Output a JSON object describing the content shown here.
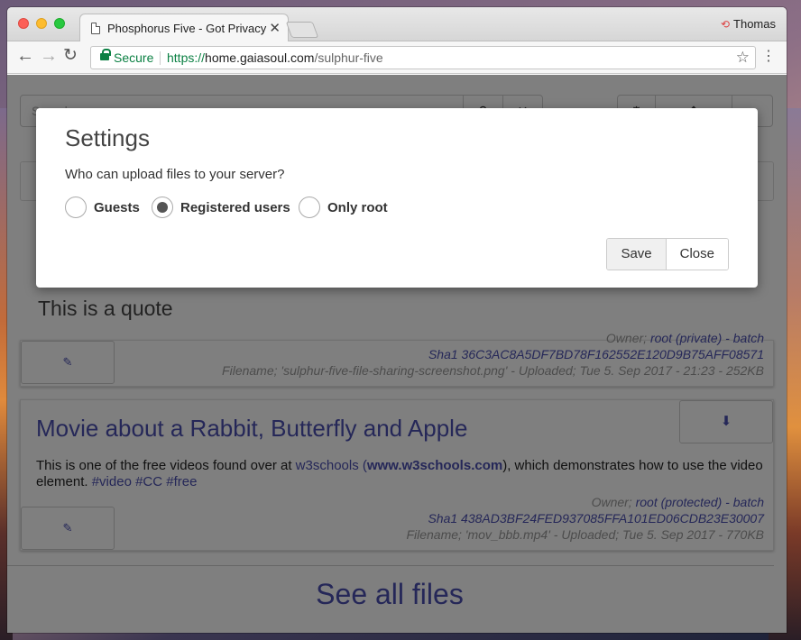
{
  "browser": {
    "tab_title": "Phosphorus Five - Got Privacy",
    "profile_name": "Thomas",
    "secure_label": "Secure",
    "url_scheme": "https://",
    "url_host": "home.gaiasoul.com",
    "url_path": "/sulphur-five"
  },
  "page": {
    "search_placeholder": "Search...",
    "quote_text": "This is a quote",
    "files": [
      {
        "owner_label": "Owner;",
        "owner_value": "root (private)",
        "owner_sep": " - ",
        "batch": "batch",
        "sha_label": "Sha1",
        "sha": "36C3AC8A5DF7BD78F162552E120D9B75AFF08571",
        "filename_line": "Filename; 'sulphur-five-file-sharing-screenshot.png' - Uploaded; Tue 5. Sep 2017 - 21:23 - 252KB"
      },
      {
        "title": "Movie about a Rabbit, Butterfly and Apple",
        "desc_prefix": "This is one of the free videos found over at ",
        "desc_link": "w3schools",
        "desc_open": " (",
        "desc_bold": "www.w3schools.com",
        "desc_suffix": "), which demonstrates how to use the video element. ",
        "tags": "#video #CC #free",
        "owner_label": "Owner;",
        "owner_value": "root (protected)",
        "owner_sep": " - ",
        "batch": "batch",
        "sha_label": "Sha1",
        "sha": "438AD3BF24FED937085FFA101ED06CDB23E30007",
        "filename_line": "Filename; 'mov_bbb.mp4' - Uploaded; Tue 5. Sep 2017 - 770KB"
      }
    ],
    "see_all": "See all files"
  },
  "modal": {
    "title": "Settings",
    "question": "Who can upload files to your server?",
    "options": [
      {
        "label": "Guests",
        "checked": false
      },
      {
        "label": "Registered users",
        "checked": true
      },
      {
        "label": "Only root",
        "checked": false
      }
    ],
    "save_label": "Save",
    "close_label": "Close"
  },
  "icons": {
    "edit": "pencil-icon",
    "download": "download-icon",
    "search": "search-icon",
    "clear": "close-icon",
    "settings": "gear-icon",
    "upload": "upload-icon",
    "home": "home-icon"
  }
}
